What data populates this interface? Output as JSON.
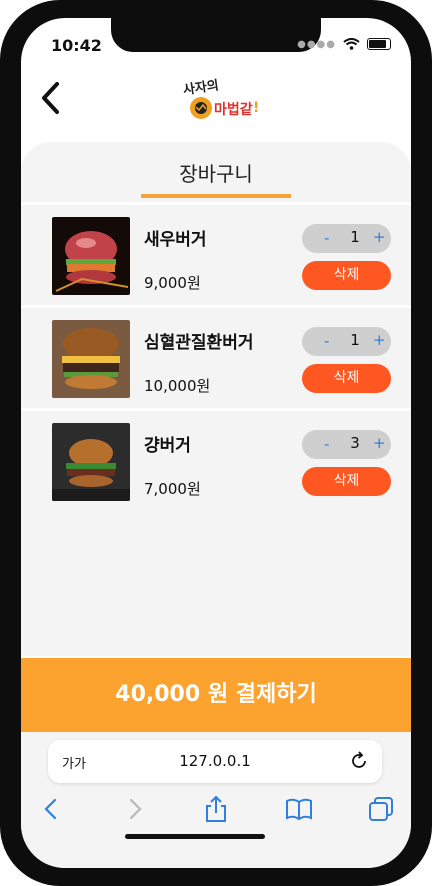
{
  "status": {
    "time": "10:42"
  },
  "header": {
    "logo_text": "사자의 마법같이"
  },
  "cart": {
    "title": "장바구니",
    "items": [
      {
        "name": "새우버거",
        "price": "9,000원",
        "qty": "1",
        "minus": "-",
        "plus": "+",
        "delete_label": "삭제"
      },
      {
        "name": "심혈관질환버거",
        "price": "10,000원",
        "qty": "1",
        "minus": "-",
        "plus": "+",
        "delete_label": "삭제"
      },
      {
        "name": "걍버거",
        "price": "7,000원",
        "qty": "3",
        "minus": "-",
        "plus": "+",
        "delete_label": "삭제"
      }
    ]
  },
  "checkout": {
    "label": "40,000 원 결제하기"
  },
  "browser": {
    "text_size": "가가",
    "url": "127.0.0.1",
    "toolbar": [
      "back-icon",
      "forward-icon",
      "share-icon",
      "bookmarks-icon",
      "tabs-icon"
    ]
  },
  "colors": {
    "accent": "#fca22e",
    "delete": "#ff5722",
    "qty_bg": "#cfcfcf",
    "link": "#2f7fe0"
  }
}
